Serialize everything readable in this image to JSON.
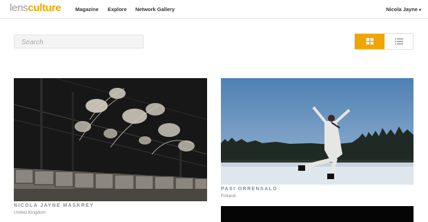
{
  "header": {
    "logo_part1": "lens",
    "logo_part2": "culture",
    "nav": [
      "Magazine",
      "Explore",
      "Network Gallery"
    ],
    "user_name": "Nicola Jayne",
    "user_caret": "▾"
  },
  "search": {
    "placeholder": "Search"
  },
  "view_toggle": {
    "active": "grid",
    "accent_color": "#f0a500"
  },
  "gallery": [
    {
      "photographer": "NICOLA JAYNE MASKREY",
      "location": "United Kingdom"
    },
    {
      "photographer": "PASI ORRENSALO",
      "location": "Finland"
    }
  ],
  "colors": {
    "accent": "#f0a500",
    "logo_gray": "#9b9b9b"
  }
}
